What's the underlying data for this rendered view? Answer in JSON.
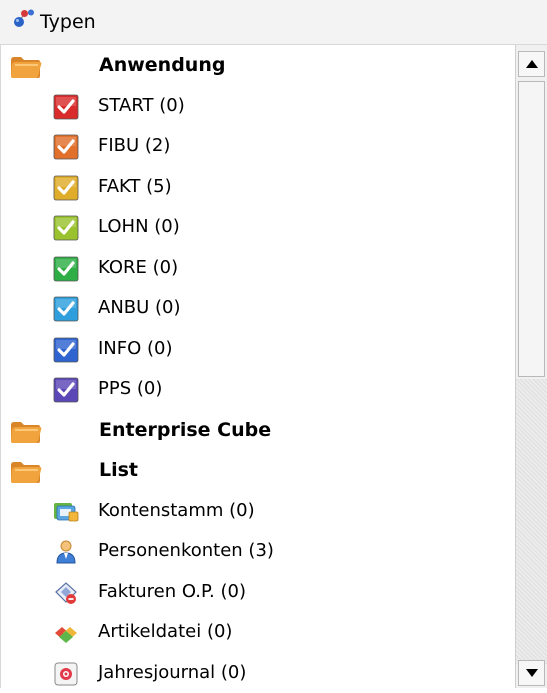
{
  "header": {
    "title": "Typen",
    "icon": "types-molecule-icon"
  },
  "groups": [
    {
      "label": "Anwendung",
      "items": [
        {
          "label": "START (0)",
          "icon": "check-icon",
          "color": "#d92b2b"
        },
        {
          "label": "FIBU (2)",
          "icon": "check-icon",
          "color": "#e0702a"
        },
        {
          "label": "FAKT (5)",
          "icon": "check-icon",
          "color": "#e0ad2a"
        },
        {
          "label": "LOHN (0)",
          "icon": "check-icon",
          "color": "#9ac22e"
        },
        {
          "label": "KORE (0)",
          "icon": "check-icon",
          "color": "#2eae45"
        },
        {
          "label": "ANBU (0)",
          "icon": "check-icon",
          "color": "#2e9fdc"
        },
        {
          "label": "INFO (0)",
          "icon": "check-icon",
          "color": "#2e63d0"
        },
        {
          "label": "PPS (0)",
          "icon": "check-icon",
          "color": "#5b47b6"
        }
      ]
    },
    {
      "label": "Enterprise Cube",
      "items": []
    },
    {
      "label": "List",
      "items": [
        {
          "label": "Kontenstamm (0)",
          "icon": "account-master-icon"
        },
        {
          "label": "Personenkonten (3)",
          "icon": "person-icon"
        },
        {
          "label": "Fakturen O.P. (0)",
          "icon": "invoice-icon"
        },
        {
          "label": "Artikeldatei (0)",
          "icon": "article-file-icon"
        },
        {
          "label": "Jahresjournal (0)",
          "icon": "journal-icon"
        }
      ]
    }
  ],
  "colors": {
    "folder": "#f1a33d",
    "header_bg": "#f3f3f3"
  }
}
